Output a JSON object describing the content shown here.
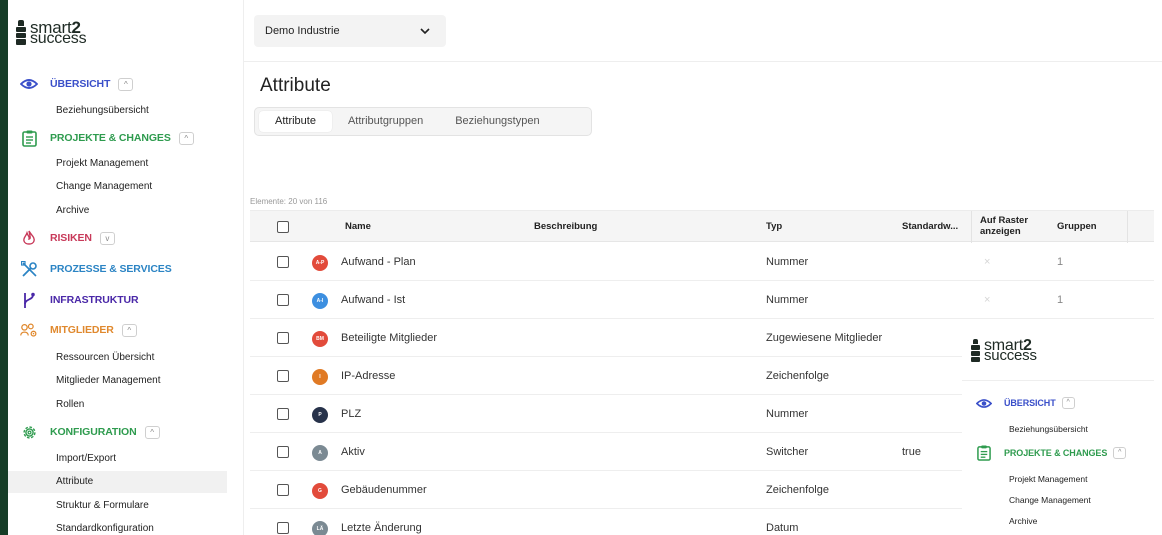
{
  "colors": {
    "frame": "#163d27",
    "uebersicht": "#3a4fc9",
    "projekte": "#2e9b4e",
    "risiken": "#c83a5a",
    "prozesse": "#2b84c4",
    "infrastruktur": "#4a28a8",
    "mitglieder": "#e0892e",
    "konfiguration": "#2e9b4e"
  },
  "brand": {
    "line1": "smart",
    "line1_bold": "2",
    "line2": "success"
  },
  "sidebar": {
    "sections": [
      {
        "label": "ÜBERSICHT",
        "icon": "eye-icon",
        "toggle": "^",
        "items": [
          "Beziehungsübersicht"
        ]
      },
      {
        "label": "PROJEKTE & CHANGES",
        "icon": "clipboard-icon",
        "toggle": "^",
        "items": [
          "Projekt Management",
          "Change Management",
          "Archive"
        ]
      },
      {
        "label": "RISIKEN",
        "icon": "flame-icon",
        "toggle": "v",
        "items": []
      },
      {
        "label": "PROZESSE & SERVICES",
        "icon": "tools-icon",
        "items": []
      },
      {
        "label": "INFRASTRUKTUR",
        "icon": "branch-icon",
        "items": []
      },
      {
        "label": "MITGLIEDER",
        "icon": "users-gear-icon",
        "toggle": "^",
        "items": [
          "Ressourcen Übersicht",
          "Mitglieder Management",
          "Rollen"
        ]
      },
      {
        "label": "KONFIGURATION",
        "icon": "gear-icon",
        "toggle": "^",
        "items": [
          "Import/Export",
          "Attribute",
          "Struktur & Formulare",
          "Standardkonfiguration"
        ]
      }
    ],
    "active_item": "Attribute"
  },
  "topbar": {
    "org_select": "Demo Industrie",
    "chevron": "chevron-down-icon"
  },
  "page": {
    "title": "Attribute",
    "tabs": [
      "Attribute",
      "Attributgruppen",
      "Beziehungstypen"
    ],
    "active_tab": "Attribute",
    "count_label": "Elemente: 20 von 116"
  },
  "table": {
    "headers": [
      "Name",
      "Beschreibung",
      "Typ",
      "Standardw...",
      "Auf Raster",
      "anzeigen",
      "Gruppen"
    ],
    "rows": [
      {
        "initials": "A-P",
        "color": "#e24b3b",
        "name": "Aufwand - Plan",
        "typ": "Nummer",
        "standard": "",
        "raster": "×",
        "gruppen": "1"
      },
      {
        "initials": "A-I",
        "color": "#3d8fe0",
        "name": "Aufwand - Ist",
        "typ": "Nummer",
        "standard": "",
        "raster": "×",
        "gruppen": "1"
      },
      {
        "initials": "BM",
        "color": "#e24b3b",
        "name": "Beteiligte Mitglieder",
        "typ": "Zugewiesene Mitglieder",
        "standard": "",
        "raster": "",
        "gruppen": ""
      },
      {
        "initials": "I",
        "color": "#e07a24",
        "name": "IP-Adresse",
        "typ": "Zeichenfolge",
        "standard": "",
        "raster": "",
        "gruppen": ""
      },
      {
        "initials": "P",
        "color": "#27324a",
        "name": "PLZ",
        "typ": "Nummer",
        "standard": "",
        "raster": "",
        "gruppen": ""
      },
      {
        "initials": "A",
        "color": "#7b8a93",
        "name": "Aktiv",
        "typ": "Switcher",
        "standard": "true",
        "raster": "",
        "gruppen": ""
      },
      {
        "initials": "G",
        "color": "#e24b3b",
        "name": "Gebäudenummer",
        "typ": "Zeichenfolge",
        "standard": "",
        "raster": "",
        "gruppen": ""
      },
      {
        "initials": "LÄ",
        "color": "#7b8a93",
        "name": "Letzte Änderung",
        "typ": "Datum",
        "standard": "",
        "raster": "",
        "gruppen": ""
      }
    ]
  },
  "overlay": {
    "sections": [
      {
        "label": "ÜBERSICHT",
        "toggle": "^",
        "items": [
          "Beziehungsübersicht"
        ]
      },
      {
        "label": "PROJEKTE & CHANGES",
        "toggle": "^",
        "items": [
          "Projekt Management",
          "Change Management",
          "Archive"
        ]
      }
    ]
  }
}
